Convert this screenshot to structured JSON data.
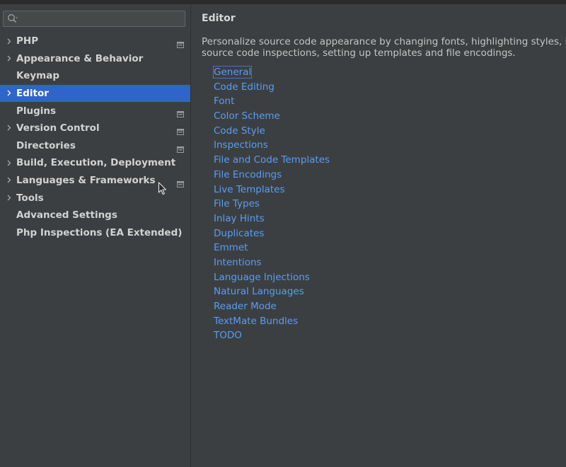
{
  "search": {
    "value": "",
    "placeholder": ""
  },
  "sidebar": {
    "items": [
      {
        "label": "PHP",
        "expandable": true,
        "project_icon": true,
        "selected": false
      },
      {
        "label": "Appearance & Behavior",
        "expandable": true,
        "project_icon": false,
        "selected": false
      },
      {
        "label": "Keymap",
        "expandable": false,
        "project_icon": false,
        "selected": false
      },
      {
        "label": "Editor",
        "expandable": true,
        "project_icon": false,
        "selected": true
      },
      {
        "label": "Plugins",
        "expandable": false,
        "project_icon": true,
        "selected": false
      },
      {
        "label": "Version Control",
        "expandable": true,
        "project_icon": true,
        "selected": false
      },
      {
        "label": "Directories",
        "expandable": false,
        "project_icon": true,
        "selected": false
      },
      {
        "label": "Build, Execution, Deployment",
        "expandable": true,
        "project_icon": false,
        "selected": false
      },
      {
        "label": "Languages & Frameworks",
        "expandable": true,
        "project_icon": true,
        "selected": false
      },
      {
        "label": "Tools",
        "expandable": true,
        "project_icon": false,
        "selected": false
      },
      {
        "label": "Advanced Settings",
        "expandable": false,
        "project_icon": false,
        "selected": false
      },
      {
        "label": "Php Inspections (EA Extended)",
        "expandable": false,
        "project_icon": false,
        "selected": false
      }
    ]
  },
  "main": {
    "title": "Editor",
    "description_line1": "Personalize source code appearance by changing fonts, highlighting styles, inden",
    "description_line2": "source code inspections, setting up templates and file encodings.",
    "links": [
      "General",
      "Code Editing",
      "Font",
      "Color Scheme",
      "Code Style",
      "Inspections",
      "File and Code Templates",
      "File Encodings",
      "Live Templates",
      "File Types",
      "Inlay Hints",
      "Duplicates",
      "Emmet",
      "Intentions",
      "Language Injections",
      "Natural Languages",
      "Reader Mode",
      "TextMate Bundles",
      "TODO"
    ],
    "focused_link": "General"
  },
  "colors": {
    "background": "#3c3f41",
    "selection": "#2f65ca",
    "link": "#589df6",
    "text": "#d2d2d2"
  },
  "icons": {
    "search": "search-icon",
    "expand": "chevron-right-icon",
    "project_scope": "project-scope-icon",
    "cursor": "mouse-pointer-icon"
  }
}
